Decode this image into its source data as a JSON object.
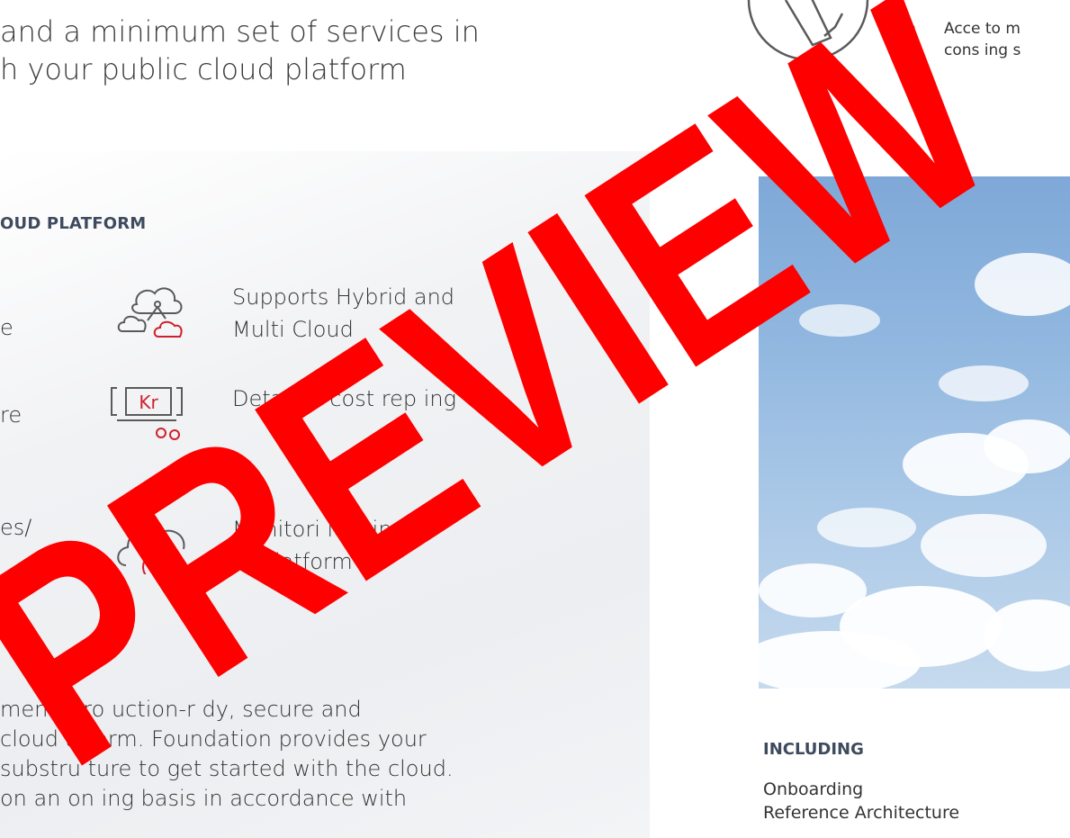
{
  "headline": {
    "line1": "and a minimum set of services in",
    "line2": "h your public cloud platform"
  },
  "top_bullet": {
    "dot": "•",
    "line1": "Acce   to m",
    "line2": "cons    ing s"
  },
  "platform_section": {
    "title": "OUD PLATFORM",
    "left_fragments": [
      "e",
      "re",
      "es/"
    ],
    "features": [
      {
        "icon": "hybrid-multi-cloud-icon",
        "label_line1": "Supports Hybrid and",
        "label_line2": "Multi Cloud"
      },
      {
        "icon": "cost-report-icon",
        "icon_text": "Kr",
        "label_line1": "Detailed cost rep    ing",
        "label_line2": ""
      },
      {
        "icon": "cloud-monitoring-icon",
        "label_line1": "Monitori     logging of",
        "label_line2": "the  latform"
      }
    ]
  },
  "paragraph": {
    "line1": "men   f pro  uction-r   dy, secure and",
    "line2": " cloud   atform. Foundation provides your",
    "line3": " substru   ture to get started with the cloud.",
    "line4": " on an on   ing basis in accordance with"
  },
  "including": {
    "title": "INCLUDING",
    "items": [
      "Onboarding",
      "Reference Architecture"
    ]
  },
  "watermark": {
    "text": "PREVIEW",
    "color": "#ff0000"
  },
  "colors": {
    "accent_red": "#d0202f",
    "heading": "#3e4a5e",
    "icon_gray": "#5a5a5a"
  }
}
